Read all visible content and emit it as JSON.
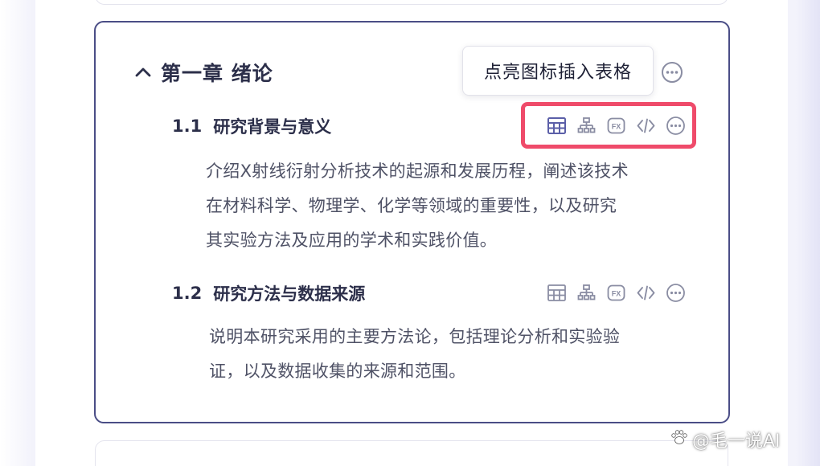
{
  "chapter": {
    "title": "第一章  绪论"
  },
  "tooltip": {
    "text": "点亮图标插入表格"
  },
  "sections": [
    {
      "number": "1.1",
      "title": "研究背景与意义",
      "lines": [
        "介绍X射线衍射分析技术的起源和发展历程，阐述该技术",
        "在材料科学、物理学、化学等领域的重要性，以及研究",
        "其实验方法及应用的学术和实践价值。"
      ]
    },
    {
      "number": "1.2",
      "title": "研究方法与数据来源",
      "lines": [
        "说明本研究采用的主要方法论，包括理论分析和实验验",
        "证，以及数据收集的来源和范围。"
      ]
    }
  ],
  "toolbar_icons": [
    "table-icon",
    "org-chart-icon",
    "formula-icon",
    "code-icon",
    "more-icon"
  ],
  "colors": {
    "accent_border": "#4a4d86",
    "highlight_red": "#ef4b6a",
    "icon_active": "#5b5fa8",
    "icon_muted": "#8a8da3"
  },
  "watermark": {
    "text": "@毛一说AI"
  }
}
